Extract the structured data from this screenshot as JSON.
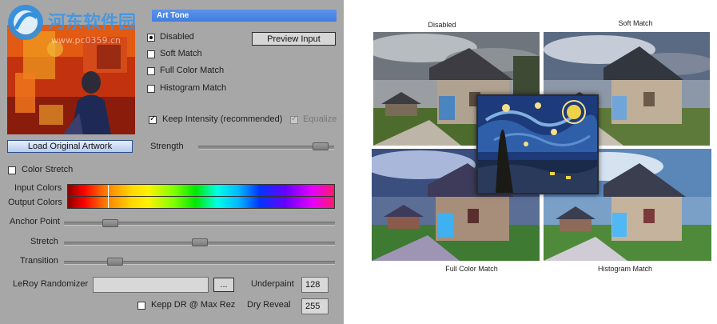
{
  "watermark": {
    "site_name": "河东软件园",
    "url": "www.pc0359.cn"
  },
  "dialog": {
    "title": "Art Tone",
    "options": {
      "disabled": {
        "label": "Disabled",
        "selected": true
      },
      "soft_match": {
        "label": "Soft Match",
        "selected": false
      },
      "full_color_match": {
        "label": "Full Color Match",
        "selected": false
      },
      "histogram_match": {
        "label": "Histogram Match",
        "selected": false
      }
    },
    "preview_input_label": "Preview Input",
    "keep_intensity": {
      "label": "Keep Intensity (recommended)",
      "checked": true
    },
    "equalize": {
      "label": "Equalize",
      "checked": true,
      "enabled": false
    },
    "load_artwork_label": "Load Original Artwork",
    "strength": {
      "label": "Strength",
      "value": 0.95
    },
    "color_stretch": {
      "label": "Color Stretch",
      "checked": false
    },
    "input_colors_label": "Input Colors",
    "output_colors_label": "Output Colors",
    "anchor_point": {
      "label": "Anchor Point",
      "value": 0.15
    },
    "stretch": {
      "label": "Stretch",
      "value": 0.5
    },
    "transition": {
      "label": "Transition",
      "value": 0.17
    },
    "randomizer": {
      "label": "LeRoy Randomizer",
      "value": "",
      "browse_label": "..."
    },
    "underpaint": {
      "label": "Underpaint",
      "value": "128"
    },
    "kepp_dr": {
      "label": "Kepp DR @ Max Rez",
      "checked": false
    },
    "dry_reveal": {
      "label": "Dry Reveal",
      "value": "255"
    }
  },
  "figure": {
    "captions": {
      "top_left": "Disabled",
      "top_right": "Soft Match",
      "bottom_left": "Full Color Match",
      "bottom_right": "Histogram Match"
    }
  },
  "colors": {
    "title_bar": "#4a89e6",
    "panel": "#a7a7a7",
    "accent_blue": "#2c4f8f"
  }
}
